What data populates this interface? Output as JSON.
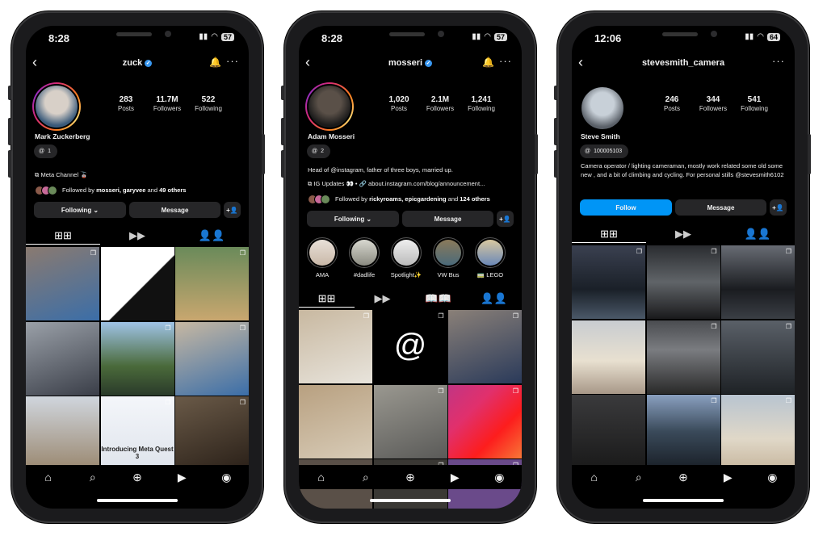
{
  "phones": [
    {
      "status": {
        "time": "8:28",
        "battery": "57"
      },
      "header": {
        "username": "zuck",
        "verified": true,
        "bell": true
      },
      "avatar": {
        "ring": true,
        "colors": [
          "#d8d0c8",
          "#3a5a7a"
        ]
      },
      "stats": [
        {
          "n": "283",
          "l": "Posts"
        },
        {
          "n": "11.7M",
          "l": "Followers"
        },
        {
          "n": "522",
          "l": "Following"
        }
      ],
      "name": "Mark Zuckerberg",
      "threads_badge": "1",
      "bio": [],
      "channel": "Meta Channel 🚡",
      "link": "",
      "followed_by": {
        "prefix": "Followed by ",
        "names": "mosseri, garyvee",
        "mid": " and ",
        "others": "49 others"
      },
      "buttons": {
        "primary": "Following ⌄",
        "primary_blue": false,
        "message": "Message"
      },
      "highlights": [],
      "tabs": [
        "grid",
        "reels",
        "tagged"
      ],
      "tiles": [
        {
          "bg": "linear-gradient(160deg,#8a7a70,#3b6ea8)"
        },
        {
          "bg": "linear-gradient(135deg,#fff 55%,#111 56%)"
        },
        {
          "bg": "linear-gradient(180deg,#6a8a5a,#c9a76f)"
        },
        {
          "bg": "linear-gradient(160deg,#9aa0a8,#3a3e48)"
        },
        {
          "bg": "linear-gradient(180deg,#9fc3e6,#4a6a3a 60%,#2a3a2a)"
        },
        {
          "bg": "linear-gradient(160deg,#c7b8a2,#3b6ea8)"
        },
        {
          "bg": "linear-gradient(180deg,#d0d6de,#9a8870)"
        },
        {
          "bg": "linear-gradient(180deg,#f4f6fa,#dfe4ec)",
          "caption": "Introducing Meta Quest 3"
        },
        {
          "bg": "linear-gradient(160deg,#6a5a48,#2a2018)"
        }
      ],
      "nav": [
        "home",
        "search",
        "create",
        "reels",
        "profile"
      ]
    },
    {
      "status": {
        "time": "8:28",
        "battery": "57"
      },
      "header": {
        "username": "mosseri",
        "verified": true,
        "bell": true
      },
      "avatar": {
        "ring": true,
        "colors": [
          "#5a5048",
          "#1a1a1a"
        ]
      },
      "stats": [
        {
          "n": "1,020",
          "l": "Posts"
        },
        {
          "n": "2.1M",
          "l": "Followers"
        },
        {
          "n": "1,241",
          "l": "Following"
        }
      ],
      "name": "Adam Mosseri",
      "threads_badge": "2",
      "bio": [
        "Head of @instagram, father of three boys, married up."
      ],
      "channel": "IG Updates 👀",
      "link": "about.instagram.com/blog/announcement...",
      "followed_by": {
        "prefix": "Followed by ",
        "names": "rickyroams, epicgardening",
        "mid": " and ",
        "others": "124 others"
      },
      "buttons": {
        "primary": "Following ⌄",
        "primary_blue": false,
        "message": "Message"
      },
      "highlights": [
        {
          "label": "AMA",
          "bg": "linear-gradient(#e8e0d8,#c9b8a8)"
        },
        {
          "label": "#dadlife",
          "bg": "linear-gradient(#d8d8d0,#8a8a80)"
        },
        {
          "label": "Spotlight✨",
          "bg": "linear-gradient(#eee,#bbb)"
        },
        {
          "label": "VW Bus",
          "bg": "linear-gradient(#8a7a5a,#4a6a7a)"
        },
        {
          "label": "🚃 LEGO",
          "bg": "linear-gradient(#d8c8a0,#6a88b8)"
        }
      ],
      "tabs": [
        "grid",
        "reels",
        "guides",
        "tagged"
      ],
      "tiles": [
        {
          "bg": "linear-gradient(160deg,#c8b8a0,#e8e4dc)"
        },
        {
          "bg": "#000",
          "logo": "@"
        },
        {
          "bg": "linear-gradient(160deg,#8a8078,#2a3a5a)"
        },
        {
          "bg": "linear-gradient(160deg,#b8a080,#d8ccb8)"
        },
        {
          "bg": "linear-gradient(160deg,#9a9890,#5a5a58)"
        },
        {
          "bg": "linear-gradient(135deg,#c13584,#e1306c,#fd1d1d,#f77737)"
        },
        {
          "bg": "#5a5048"
        },
        {
          "bg": "#3a3834"
        },
        {
          "bg": "#6a4a8a"
        }
      ],
      "nav": [
        "home",
        "search",
        "create",
        "reels",
        "profile"
      ]
    },
    {
      "status": {
        "time": "12:06",
        "battery": "64"
      },
      "header": {
        "username": "stevesmith_camera",
        "verified": false,
        "bell": false
      },
      "avatar": {
        "ring": false,
        "colors": [
          "#c8d0d8",
          "#5a6068"
        ]
      },
      "stats": [
        {
          "n": "246",
          "l": "Posts"
        },
        {
          "n": "344",
          "l": "Followers"
        },
        {
          "n": "541",
          "l": "Following"
        }
      ],
      "name": "Steve Smith",
      "threads_badge": "100005103",
      "bio": [
        "Camera operator / lighting cameraman,  mostly work related some old some new , and a bit of climbing and cycling. For personal stills @stevesmith6102"
      ],
      "channel": "",
      "link": "",
      "followed_by": null,
      "buttons": {
        "primary": "Follow",
        "primary_blue": true,
        "message": "Message"
      },
      "highlights": [],
      "tabs": [
        "grid",
        "reels",
        "tagged"
      ],
      "tiles": [
        {
          "bg": "linear-gradient(180deg,#3a4050,#1a2028 60%,#4a5868)"
        },
        {
          "bg": "linear-gradient(180deg,#2a2c30,#606468 50%,#1a1a1c)"
        },
        {
          "bg": "linear-gradient(180deg,#686c74,#1a1c20 60%,#3a3e44)"
        },
        {
          "bg": "linear-gradient(180deg,#c8ccd0,#e8e0d0 55%,#a89888)"
        },
        {
          "bg": "linear-gradient(180deg,#4a4c50,#7a7c80 40%,#2a2a2a)"
        },
        {
          "bg": "linear-gradient(180deg,#5a6068,#1e2226)"
        },
        {
          "bg": "linear-gradient(180deg,#3a3a3c,#1a1a1a)"
        },
        {
          "bg": "linear-gradient(180deg,#8aa0c0,#3a4a5a 50%,#1a2028)"
        },
        {
          "bg": "linear-gradient(180deg,#b8c4d0,#e0d8c8 60%,#c8b8a0)"
        }
      ],
      "nav": [
        "home",
        "search",
        "create",
        "reels",
        "profile"
      ]
    }
  ],
  "icons": {
    "grid": "⊞",
    "reels": "▶",
    "guides": "📖",
    "tagged": "👤",
    "home": "⌂",
    "search": "⌕",
    "create": "⊕",
    "profile": "◉"
  }
}
